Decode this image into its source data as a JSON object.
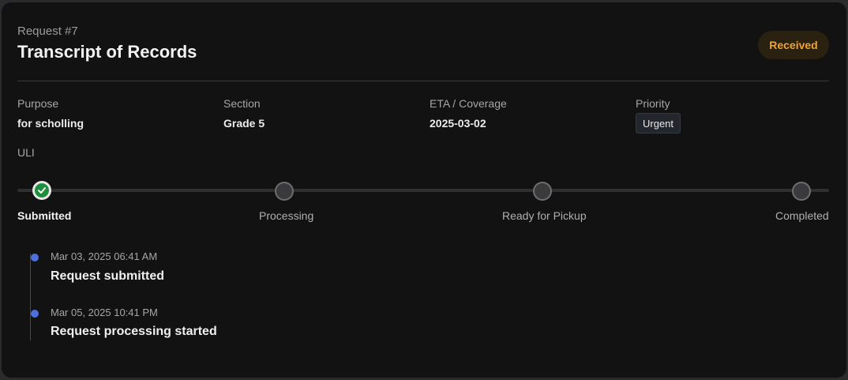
{
  "request": {
    "number": "Request #7",
    "title": "Transcript of Records",
    "status": "Received"
  },
  "fields": {
    "purpose_label": "Purpose",
    "purpose_value": "for scholling",
    "section_label": "Section",
    "section_value": "Grade 5",
    "eta_label": "ETA / Coverage",
    "eta_value": "2025-03-02",
    "priority_label": "Priority",
    "priority_value": "Urgent",
    "uli_label": "ULI"
  },
  "progress": {
    "current_step": 1,
    "steps": [
      {
        "label": "Submitted",
        "state": "done"
      },
      {
        "label": "Processing",
        "state": "pending"
      },
      {
        "label": "Ready for Pickup",
        "state": "pending"
      },
      {
        "label": "Completed",
        "state": "pending"
      }
    ]
  },
  "timeline": [
    {
      "time": "Mar 03, 2025 06:41 AM",
      "event": "Request submitted"
    },
    {
      "time": "Mar 05, 2025 10:41 PM",
      "event": "Request processing started"
    }
  ],
  "colors": {
    "status_badge_text": "#f0a232",
    "step_done": "#1e8e3e",
    "timeline_dot": "#4d6fe0"
  }
}
